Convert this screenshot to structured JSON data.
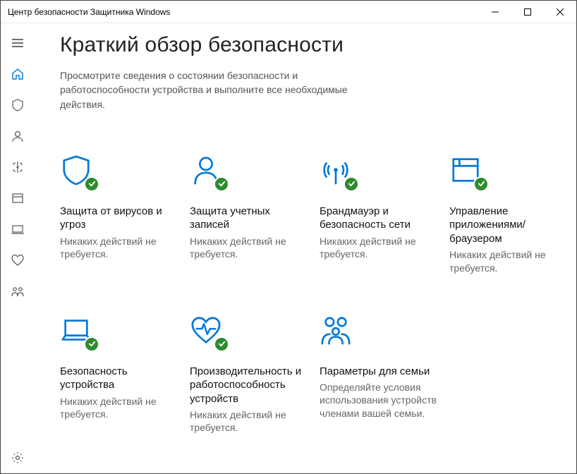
{
  "window": {
    "title": "Центр безопасности Защитника Windows"
  },
  "header": {
    "title": "Краткий обзор безопасности",
    "subtitle": "Просмотрите сведения о состоянии безопасности и работоспособности устройства и выполните все необходимые действия."
  },
  "cards": [
    {
      "title": "Защита от вирусов и угроз",
      "sub": "Никаких действий не требуется."
    },
    {
      "title": "Защита учетных записей",
      "sub": "Никаких действий не требуется."
    },
    {
      "title": "Брандмауэр и безопасность сети",
      "sub": "Никаких действий не требуется."
    },
    {
      "title": "Управление приложениями/браузером",
      "sub": "Никаких действий не требуется."
    },
    {
      "title": "Безопасность устройства",
      "sub": "Никаких действий не требуется."
    },
    {
      "title": "Производительность и работоспособность устройств",
      "sub": "Никаких действий не требуется."
    },
    {
      "title": "Параметры для семьи",
      "sub": "Определяйте условия использования устройств членами вашей семьи."
    }
  ]
}
